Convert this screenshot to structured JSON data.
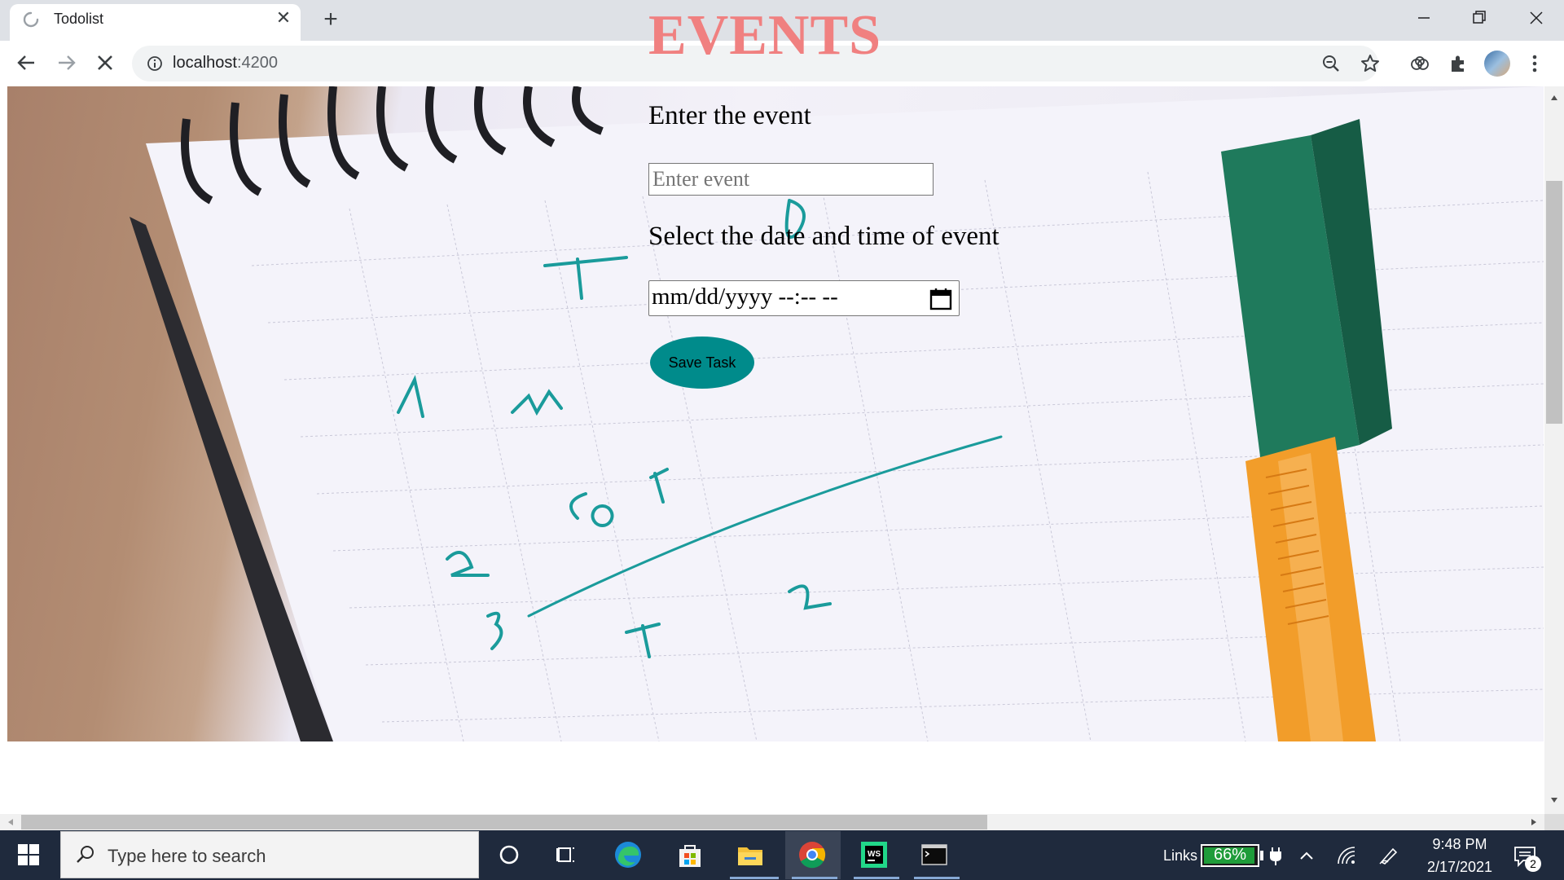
{
  "browser": {
    "tab_title": "Todolist",
    "url_host": "localhost",
    "url_port": ":4200",
    "icons": [
      "loading-spinner-icon",
      "close-icon",
      "plus-icon",
      "back-arrow-icon",
      "forward-arrow-icon",
      "stop-icon",
      "info-icon",
      "zoom-out-icon",
      "star-icon",
      "extension-puzzle-icon",
      "profile-avatar",
      "more-vert-icon"
    ]
  },
  "page": {
    "title": "EVENTS",
    "event_label": "Enter the event",
    "event_placeholder": "Enter event",
    "date_label": "Select the date and time of event",
    "date_placeholder": "mm/dd/yyyy --:-- --",
    "save_button": "Save Task",
    "colors": {
      "title": "#f08080",
      "button": "#008b8b"
    }
  },
  "taskbar": {
    "search_placeholder": "Type here to search",
    "links_label": "Links",
    "battery_percent": "66%",
    "time": "9:48 PM",
    "date": "2/17/2021",
    "notification_count": "2"
  }
}
